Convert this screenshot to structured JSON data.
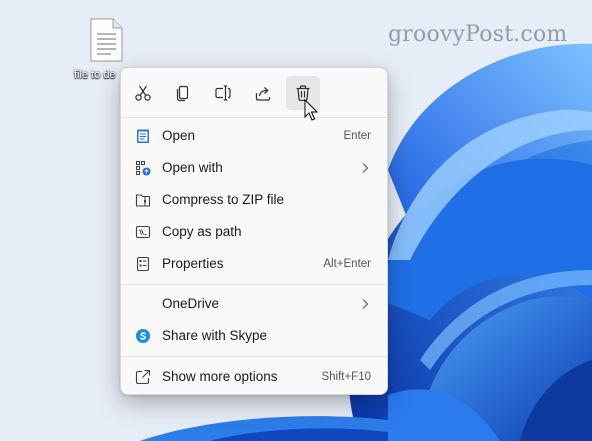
{
  "watermark": "groovyPost.com",
  "desktop_icon": {
    "label": "file to de",
    "icon": "document-file-icon"
  },
  "toolbar": [
    {
      "name": "cut-button",
      "icon": "scissors-icon",
      "title": "Cut"
    },
    {
      "name": "copy-button",
      "icon": "copy-icon",
      "title": "Copy"
    },
    {
      "name": "rename-button",
      "icon": "rename-icon",
      "title": "Rename"
    },
    {
      "name": "share-button",
      "icon": "share-icon",
      "title": "Share"
    },
    {
      "name": "delete-button",
      "icon": "trash-icon",
      "title": "Delete",
      "hovered": true
    }
  ],
  "menu": {
    "open": {
      "label": "Open",
      "shortcut": "Enter",
      "icon": "notepad-icon"
    },
    "open_with": {
      "label": "Open with",
      "icon": "open-with-icon",
      "submenu": true
    },
    "compress": {
      "label": "Compress to ZIP file",
      "icon": "zip-folder-icon"
    },
    "copy_path": {
      "label": "Copy as path",
      "icon": "copy-path-icon"
    },
    "properties": {
      "label": "Properties",
      "shortcut": "Alt+Enter",
      "icon": "properties-icon"
    },
    "onedrive": {
      "label": "OneDrive",
      "submenu": true
    },
    "skype": {
      "label": "Share with Skype",
      "icon": "skype-icon"
    },
    "more": {
      "label": "Show more options",
      "shortcut": "Shift+F10",
      "icon": "show-more-icon"
    }
  },
  "colors": {
    "accent": "#1565d8",
    "wallpaper": "#e7edf7",
    "menu_bg": "#f9f9f9"
  }
}
